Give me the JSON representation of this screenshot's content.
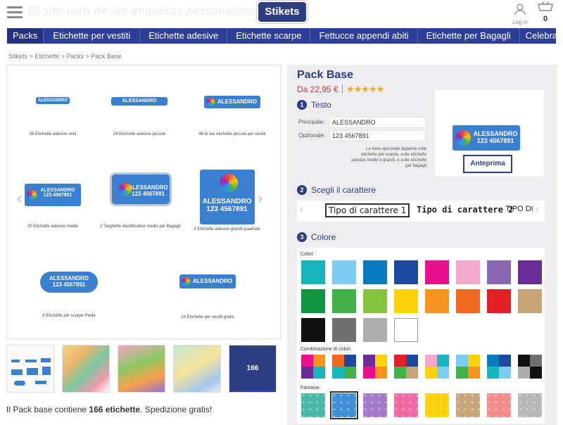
{
  "header": {
    "banner": "El sito web de las etiquetas personalizadas",
    "logo": "Stikets",
    "login": "Log in",
    "cart_count": "0"
  },
  "nav": [
    "Packs",
    "Etichette per vestiti",
    "Etichette adesive",
    "Etichette scarpe",
    "Fettucce appendi abiti",
    "Etichette per Bagagli",
    "Celebrazioni"
  ],
  "breadcrumb": "Stikets > Etichette > Packs > Pack Base",
  "gallery": {
    "label_name": "ALESSANDRO",
    "label_phone": "123 4567891",
    "captions": [
      "36 Etichette adesive mini",
      "24 Etichette adesive piccole",
      "48 le tue etichette piccole per vestiti",
      "20 Etichette adesive medie",
      "2 Targhette identificative medie per Bagagli",
      "4 Etichette adesive grandi quadrate",
      "8 Etichette per scarpe Piede",
      "24 Etichette per vestiti gratis"
    ]
  },
  "thumbs": {
    "last": "166"
  },
  "description": {
    "prefix": "Il Pack base contiene ",
    "count": "166 etichette",
    "suffix": ". Spedizione gratis!"
  },
  "product": {
    "title": "Pack Base",
    "price": "Da 22,95 €",
    "stars": "★★★★★",
    "rating": 5
  },
  "text_section": {
    "number": "1",
    "title": "Testo",
    "main_label": "Principale:",
    "main_value": "ALESSANDRO",
    "opt_label": "Opzionale:",
    "opt_value": "123 4567891",
    "note": "La linea opzionale apparirà sulle etichette per scarpe, sulle etichette adesive medie e grandi, e sulle etichette per bagagli",
    "preview_button": "Anteprima"
  },
  "font_section": {
    "number": "2",
    "title": "Scegli il carattere",
    "options": [
      "Tipo di carattere 1",
      "Tipo di carattere 2",
      "TIPO DI"
    ]
  },
  "color_section": {
    "number": "3",
    "title": "Colore",
    "colors_label": "Colori :",
    "combo_label": "Combinazione di colori:",
    "pattern_label": "Fantasie:",
    "colors": [
      "#18b5bd",
      "#7dcdf2",
      "#0a7bbf",
      "#1b49a0",
      "#ea0f8d",
      "#f3a9cb",
      "#8a67b3",
      "#6a2c96",
      "#109643",
      "#43b04a",
      "#86c440",
      "#fcd20a",
      "#f7941d",
      "#f26a21",
      "#e41e26",
      "#c6a477",
      "#111111",
      "#707070",
      "#adadad",
      "#ffffff"
    ],
    "combos": [
      [
        "#ea0f8d",
        "#f7941d",
        "#6a2c96",
        "#18b5bd"
      ],
      [
        "#f26a21",
        "#1b49a0",
        "#18b5bd",
        "#43b04a"
      ],
      [
        "#6a2c96",
        "#fcd20a",
        "#ea0f8d",
        "#f7941d"
      ],
      [
        "#e41e26",
        "#1b49a0",
        "#43b04a",
        "#c6a477"
      ],
      [
        "#f3a9cb",
        "#18b5bd",
        "#fcd20a",
        "#7dcdf2"
      ],
      [
        "#7dcdf2",
        "#fcd20a",
        "#43b04a",
        "#f7941d"
      ],
      [
        "#0a7bbf",
        "#1b49a0",
        "#18b5bd",
        "#7dcdf2"
      ],
      [
        "#111111",
        "#707070",
        "#adadad",
        "#111111"
      ]
    ],
    "patterns": [
      "#4ab8a6",
      "#3f8fd6",
      "#a57bc9",
      "#f06aa6",
      "#fcd20a",
      "#c8a67c",
      "#f28c8c",
      "#b8b8b8"
    ]
  }
}
